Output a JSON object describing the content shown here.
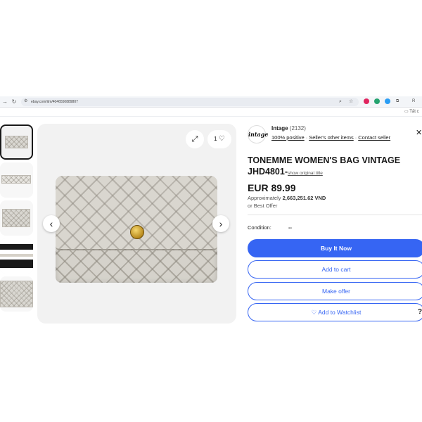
{
  "browser": {
    "url": "ebay.com/itm/4046550889807",
    "bookmark_folder": "Tất c"
  },
  "gallery": {
    "expand_icon": "expand-icon",
    "watch_count": "1",
    "prev_icon": "chevron-left-icon",
    "next_icon": "chevron-right-icon"
  },
  "seller": {
    "logo_text": "intage",
    "name": "Intage",
    "feedback_count": "(2132)",
    "positive": "100% positive",
    "other_items": "Seller's other items",
    "contact": "Contact seller"
  },
  "listing": {
    "title": "TONEMME WOMEN'S BAG VINTAGE JHD4801-",
    "show_original": "show original title",
    "price": "EUR 89.99",
    "approx_label": "Approximately",
    "approx_value": "2,663,251.62 VND",
    "best_offer": "or Best Offer",
    "condition_label": "Condition:",
    "condition_value": "--"
  },
  "actions": {
    "buy_now": "Buy It Now",
    "add_to_cart": "Add to cart",
    "make_offer": "Make offer",
    "watchlist": "Add to Watchlist"
  },
  "colors": {
    "accent": "#3665f3",
    "text": "#191919",
    "gold_clasp": "#d4a62a"
  }
}
